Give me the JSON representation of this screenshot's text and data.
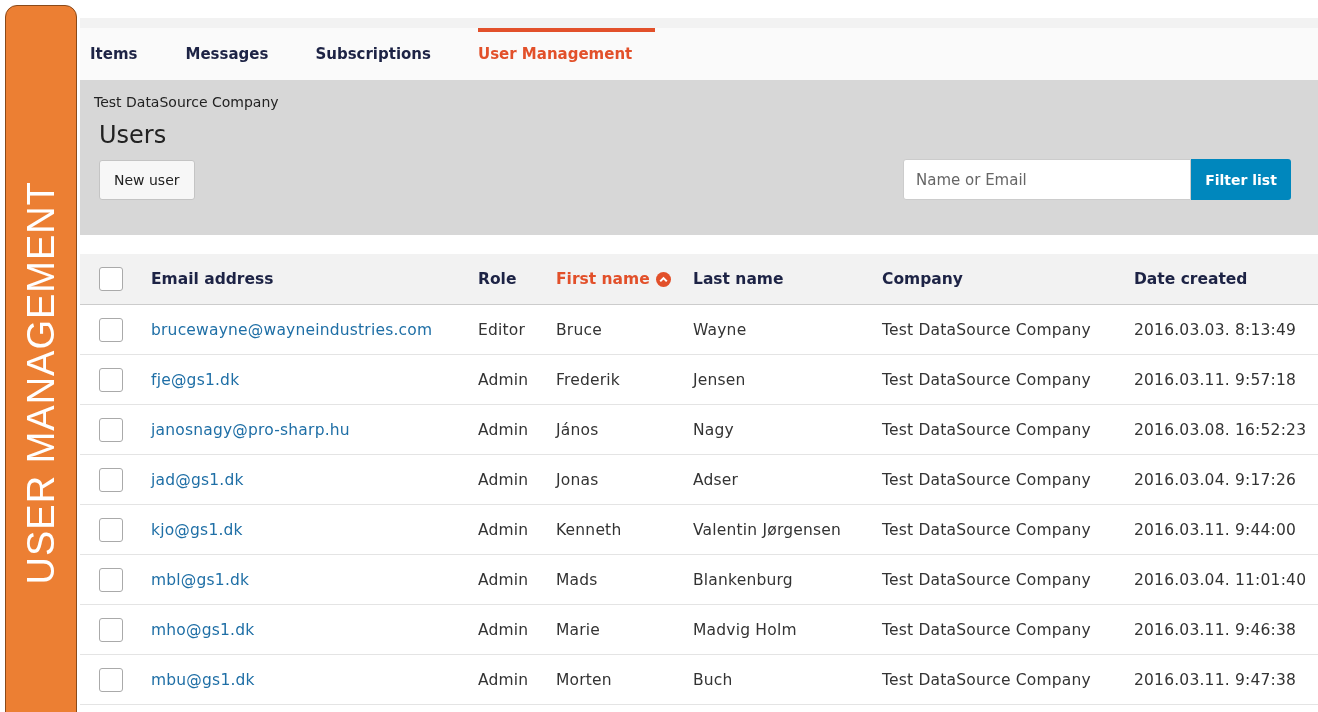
{
  "side_label": "USER MANAGEMENT",
  "tabs": [
    {
      "label": "Items",
      "selected": false
    },
    {
      "label": "Messages",
      "selected": false
    },
    {
      "label": "Subscriptions",
      "selected": false
    },
    {
      "label": "User Management",
      "selected": true
    }
  ],
  "header": {
    "company": "Test DataSource Company",
    "title": "Users",
    "new_button": "New user",
    "filter": {
      "placeholder": "Name or Email",
      "button": "Filter list"
    }
  },
  "table": {
    "select_all_checked": false,
    "columns": [
      {
        "label": "Email address",
        "sorted": false
      },
      {
        "label": "Role",
        "sorted": false
      },
      {
        "label": "First name",
        "sorted": true
      },
      {
        "label": "Last name",
        "sorted": false
      },
      {
        "label": "Company",
        "sorted": false
      },
      {
        "label": "Date created",
        "sorted": false
      }
    ],
    "rows": [
      {
        "checked": false,
        "cells": [
          "brucewayne@wayneindustries.com",
          "Editor",
          "Bruce",
          "Wayne",
          "Test DataSource Company",
          "2016.03.03. 8:13:49"
        ]
      },
      {
        "checked": false,
        "cells": [
          "fje@gs1.dk",
          "Admin",
          "Frederik",
          "Jensen",
          "Test DataSource Company",
          "2016.03.11. 9:57:18"
        ]
      },
      {
        "checked": false,
        "cells": [
          "janosnagy@pro-sharp.hu",
          "Admin",
          "János",
          "Nagy",
          "Test DataSource Company",
          "2016.03.08. 16:52:23"
        ]
      },
      {
        "checked": false,
        "cells": [
          "jad@gs1.dk",
          "Admin",
          "Jonas",
          "Adser",
          "Test DataSource Company",
          "2016.03.04. 9:17:26"
        ]
      },
      {
        "checked": false,
        "cells": [
          "kjo@gs1.dk",
          "Admin",
          "Kenneth",
          "Valentin Jørgensen",
          "Test DataSource Company",
          "2016.03.11. 9:44:00"
        ]
      },
      {
        "checked": false,
        "cells": [
          "mbl@gs1.dk",
          "Admin",
          "Mads",
          "Blankenburg",
          "Test DataSource Company",
          "2016.03.04. 11:01:40"
        ]
      },
      {
        "checked": false,
        "cells": [
          "mho@gs1.dk",
          "Admin",
          "Marie",
          "Madvig Holm",
          "Test DataSource Company",
          "2016.03.11. 9:46:38"
        ]
      },
      {
        "checked": false,
        "cells": [
          "mbu@gs1.dk",
          "Admin",
          "Morten",
          "Buch",
          "Test DataSource Company",
          "2016.03.11. 9:47:38"
        ]
      }
    ]
  }
}
